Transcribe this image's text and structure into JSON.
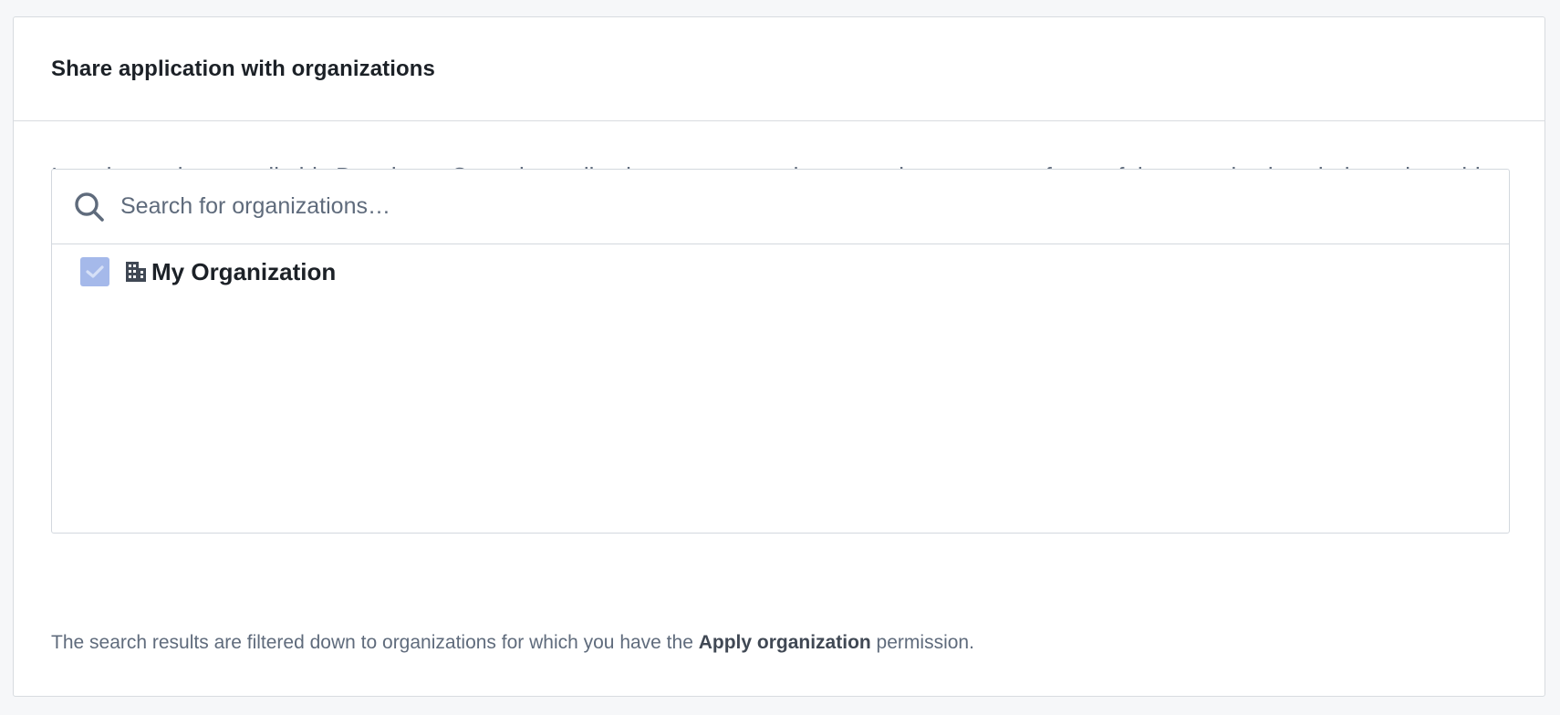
{
  "card": {
    "title": "Share application with organizations",
    "description": "In order to view or edit this Developer Console application, users must be a member or guest of one of the organizations below, alongside being granted a role in the card above."
  },
  "search": {
    "placeholder": "Search for organizations…",
    "value": "",
    "icon": "search-icon"
  },
  "organizations": [
    {
      "name": "My Organization",
      "checked": true,
      "disabled": true,
      "icon": "building-icon"
    }
  ],
  "footnote": {
    "prefix": "The search results are filtered down to organizations for which you have the ",
    "permission": "Apply organization",
    "suffix": " permission."
  },
  "colors": {
    "checkbox_disabled_checked": "#a5b9ea",
    "text_muted": "#5f6b7c",
    "text_dark": "#1c2127",
    "border": "#d3d8de"
  }
}
